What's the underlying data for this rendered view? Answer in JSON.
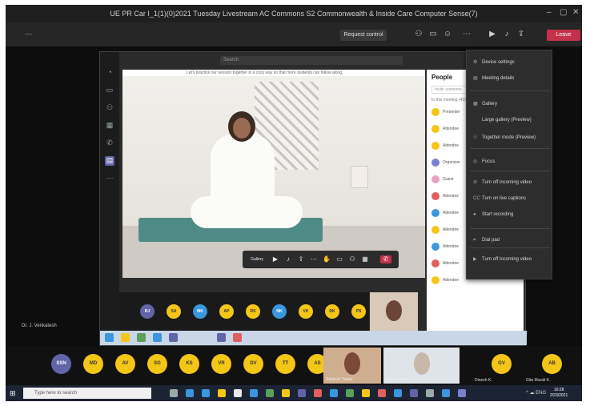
{
  "window": {
    "title": "UE PR Car I_1(1)(0)2021 Tuesday Livestream AC Commons S2 Commonwealth & Inside Care Computer Sense(7)"
  },
  "meeting_toolbar": {
    "timer": "—",
    "share_tray": "Request control",
    "leave": "Leave",
    "more_icon": "more-icon"
  },
  "shared_window": {
    "search_placeholder": "Search"
  },
  "video": {
    "top_text": "Let's practice our session together in a cozy way so that more students can follow along",
    "control_label": "Gallery"
  },
  "people_panel": {
    "title": "People",
    "search_placeholder": "Invite someone",
    "section": "In this meeting (43)",
    "rows": [
      "Presenter",
      "Attendee",
      "Attendee",
      "Organizer",
      "Guest",
      "Attendee",
      "Attendee",
      "Attendee",
      "Attendee",
      "Attendee",
      "Attendee"
    ]
  },
  "menu": {
    "items": [
      {
        "icon": "settings-icon",
        "label": "Device settings"
      },
      {
        "icon": "notes-icon",
        "label": "Meeting details"
      },
      {
        "icon": "gallery-icon",
        "label": "Gallery"
      },
      {
        "icon": "",
        "label": "Large gallery (Preview)"
      },
      {
        "icon": "together-icon",
        "label": "Together mode (Preview)"
      },
      {
        "icon": "focus-icon",
        "label": "Focus"
      },
      {
        "icon": "video-off-icon",
        "label": "Turn off incoming video"
      },
      {
        "icon": "caption-icon",
        "label": "Turn on live captions"
      },
      {
        "icon": "record-icon",
        "label": "Start recording"
      },
      {
        "icon": "dialpad-icon",
        "label": "Dial pad"
      },
      {
        "icon": "video-icon",
        "label": "Turn off incoming video"
      }
    ]
  },
  "inner_roster": [
    {
      "initials": "RJ",
      "color": "#6264a7"
    },
    {
      "initials": "SA",
      "color": "#f5c518"
    },
    {
      "initials": "MK",
      "color": "#3a96dd"
    },
    {
      "initials": "AP",
      "color": "#f5c518"
    },
    {
      "initials": "RS",
      "color": "#f5c518"
    },
    {
      "initials": "NK",
      "color": "#3a96dd"
    },
    {
      "initials": "VK",
      "color": "#f5c518"
    },
    {
      "initials": "DK",
      "color": "#f5c518"
    },
    {
      "initials": "PS",
      "color": "#f5c518"
    }
  ],
  "self_name": "Dr. J. Venkatesh",
  "roster": [
    {
      "initials": "SSN",
      "color": "#6264a7"
    },
    {
      "initials": "MD",
      "color": "#f5c518"
    },
    {
      "initials": "AV",
      "color": "#f5c518"
    },
    {
      "initials": "SG",
      "color": "#f5c518"
    },
    {
      "initials": "KS",
      "color": "#f5c518"
    },
    {
      "initials": "VR",
      "color": "#f5c518"
    },
    {
      "initials": "DV",
      "color": "#f5c518"
    },
    {
      "initials": "TT",
      "color": "#f5c518"
    },
    {
      "initials": "AS",
      "color": "#f5c518"
    },
    {
      "initials": "GV",
      "color": "#f5c518"
    },
    {
      "initials": "AB",
      "color": "#f5c518"
    }
  ],
  "cams": [
    {
      "label": "Santosh Yadav"
    },
    {
      "label": "Ravi Kumar"
    }
  ],
  "roster_labels": {
    "left": "Dinesh K.",
    "right": "Gita Murali K."
  },
  "taskbar": {
    "search_placeholder": "Type here to search",
    "clock_time": "10:28",
    "clock_date": "2/23/2021",
    "tray": "^ ☁ ENG"
  }
}
